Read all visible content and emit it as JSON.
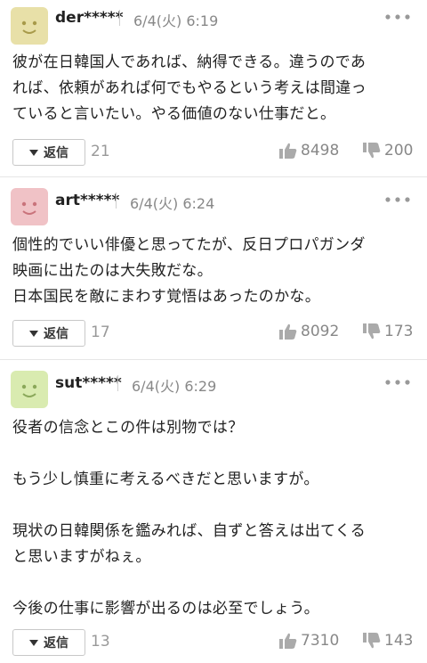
{
  "comments": [
    {
      "username": "der*****",
      "time": "6/4(火) 6:19",
      "avatar_color": "#e8e0a8",
      "lines": [
        "彼が在日韓国人であれば、納得できる。違うのであ",
        "れば、依頼があれば何でもやるという考えは間違っ",
        "ていると言いたい。やる価値のない仕事だと。"
      ],
      "reply_label": "返信",
      "reply_count": "21",
      "likes": "8498",
      "dislikes": "200"
    },
    {
      "username": "art*****",
      "time": "6/4(火) 6:24",
      "avatar_color": "#f0c2c6",
      "lines": [
        "個性的でいい俳優と思ってたが、反日プロパガンダ",
        "映画に出たのは大失敗だな。",
        "日本国民を敵にまわす覚悟はあったのかな。"
      ],
      "reply_label": "返信",
      "reply_count": "17",
      "likes": "8092",
      "dislikes": "173"
    },
    {
      "username": "sut*****",
      "time": "6/4(火) 6:29",
      "avatar_color": "#d9ebb0",
      "lines": [
        "役者の信念とこの件は別物では？",
        "",
        "もう少し慎重に考えるべきだと思いますが。",
        "",
        "現状の日韓関係を鑑みれば、自ずと答えは出てくる",
        "と思いますがねぇ。",
        "",
        "今後の仕事に影響が出るのは必至でしょう。"
      ],
      "reply_label": "返信",
      "reply_count": "13",
      "likes": "7310",
      "dislikes": "143"
    }
  ]
}
